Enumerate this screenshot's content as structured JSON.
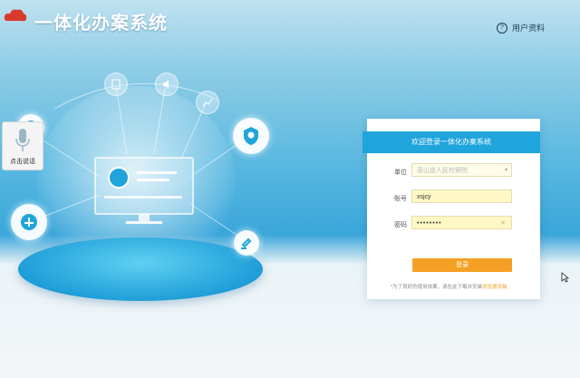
{
  "header": {
    "title": "一体化办案系统",
    "profile_label": "用户资料",
    "help_glyph": "?"
  },
  "voice": {
    "label": "点击说话"
  },
  "login": {
    "title": "欢迎登录一体化办案系统",
    "unit_label": "单位",
    "unit_placeholder": "唐山道人民检察院",
    "account_label": "账号",
    "account_value": "xsjcy",
    "password_label": "密码",
    "password_value": "••••••••",
    "clear_glyph": "✕",
    "chevron_glyph": "▾",
    "submit_label": "登录",
    "tip_text": "*为了良好的使用效果，请在此下载并安装",
    "tip_link": "浏览器安装"
  },
  "colors": {
    "accent_blue": "#1fa4dc",
    "login_button": "#f4a024",
    "input_bg": "#fdf8c4"
  }
}
